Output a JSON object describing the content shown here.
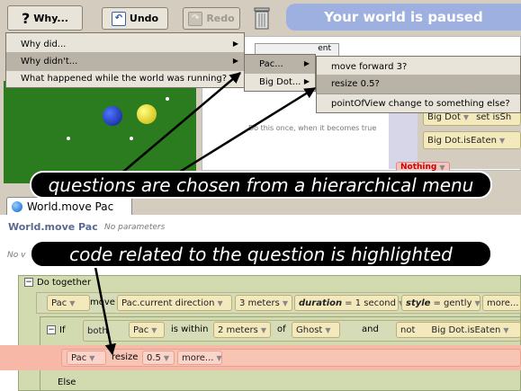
{
  "toolbar": {
    "why_label": "Why...",
    "why_icon": "?",
    "undo_label": "Undo",
    "redo_label": "Redo",
    "status_text": "Your world is paused"
  },
  "why_menu": {
    "items": [
      "Why did...",
      "Why didn't...",
      "What happened while the world was running?"
    ]
  },
  "object_menu": {
    "items": [
      "Pac...",
      "Big Dot..."
    ]
  },
  "question_menu": {
    "items": [
      "move forward 3?",
      "resize 0.5?",
      "pointOfView change to something else?"
    ]
  },
  "events": {
    "do_once": "Do this once, when it becomes true",
    "tile_1_obj": "Big Dot",
    "tile_1_method": "set isSh",
    "tile_2": "Big Dot.isEaten",
    "tile_3": "Nothing",
    "tab_fragment": "ent"
  },
  "editor": {
    "tab_label": "World.move Pac",
    "method_title": "World.move Pac",
    "parameters": "No parameters",
    "variables_fragment": "No v"
  },
  "code": {
    "do_together": "Do together",
    "pac": "Pac",
    "move": "move",
    "direction": "Pac.current direction",
    "amount": "3 meters",
    "duration_key": "duration",
    "duration_val": "= 1 second",
    "style_key": "style",
    "style_val": "= gently",
    "more": "more...",
    "if_label": "If",
    "both": "both",
    "is_within": "is within",
    "distance": "2 meters",
    "of": "of",
    "ghost": "Ghost",
    "and": "and",
    "not": "not",
    "is_eaten": "Big Dot.isEaten",
    "resize": "resize",
    "resize_val": "0.5",
    "else_label": "Else",
    "minus": "−"
  },
  "callouts": {
    "top": "questions are chosen from a hierarchical menu",
    "bottom": "code related to the question is highlighted"
  },
  "colors": {
    "highlight": "#f8b8a8",
    "scene_green": "#2a7c1e",
    "accent_blue": "#bccbe8"
  }
}
